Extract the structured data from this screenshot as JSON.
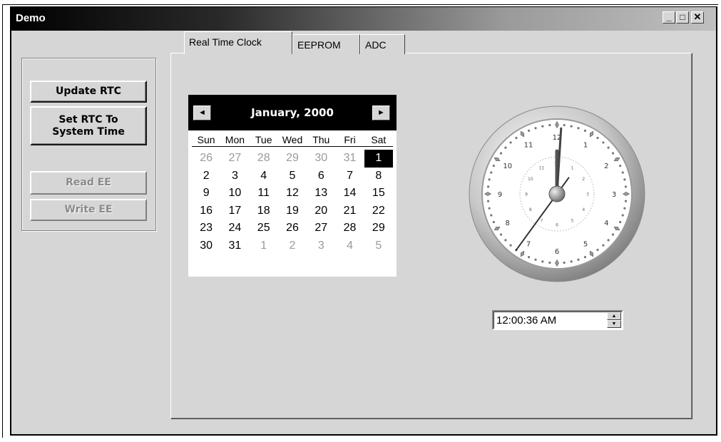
{
  "window": {
    "title": "Demo",
    "minimize": "_",
    "maximize": "□",
    "close": "✕"
  },
  "buttons": {
    "update_rtc": "Update RTC",
    "set_rtc_line1": "Set RTC To",
    "set_rtc_line2": "System Time",
    "read_ee": "Read EE",
    "write_ee": "Write EE"
  },
  "tabs": [
    {
      "label": "Real Time Clock",
      "active": true
    },
    {
      "label": "EEPROM",
      "active": false
    },
    {
      "label": "ADC",
      "active": false
    }
  ],
  "calendar": {
    "month_label": "January, 2000",
    "prev": "◄",
    "next": "►",
    "weekdays": [
      "Sun",
      "Mon",
      "Tue",
      "Wed",
      "Thu",
      "Fri",
      "Sat"
    ],
    "weeks": [
      [
        "26",
        "27",
        "28",
        "29",
        "30",
        "31",
        "1"
      ],
      [
        "2",
        "3",
        "4",
        "5",
        "6",
        "7",
        "8"
      ],
      [
        "9",
        "10",
        "11",
        "12",
        "13",
        "14",
        "15"
      ],
      [
        "16",
        "17",
        "18",
        "19",
        "20",
        "21",
        "22"
      ],
      [
        "23",
        "24",
        "25",
        "26",
        "27",
        "28",
        "29"
      ],
      [
        "30",
        "31",
        "1",
        "2",
        "3",
        "4",
        "5"
      ]
    ],
    "selected_day": "1"
  },
  "clock": {
    "numerals": [
      "12",
      "1",
      "2",
      "3",
      "4",
      "5",
      "6",
      "7",
      "8",
      "9",
      "10",
      "11"
    ],
    "hour": 12,
    "minute": 0,
    "second": 36
  },
  "time_field": {
    "value": "12:00:36 AM",
    "up": "▲",
    "down": "▼"
  }
}
